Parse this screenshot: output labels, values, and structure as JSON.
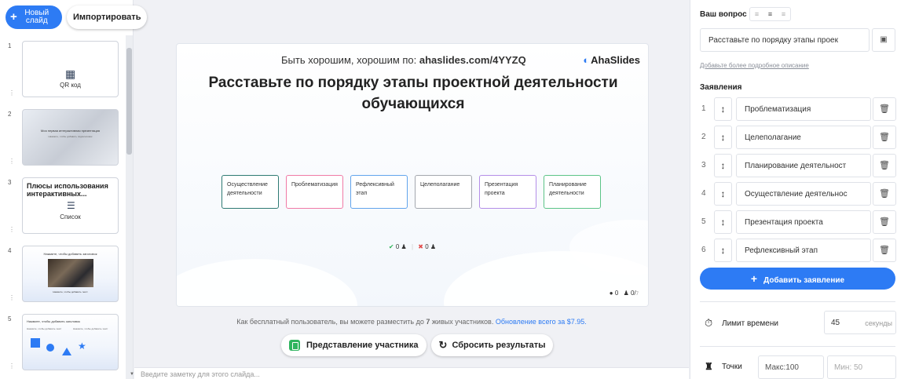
{
  "sidebar": {
    "new_slide_label": "Новый слайд",
    "import_label": "Импортировать",
    "slides": [
      {
        "num": "1",
        "label": "QR код"
      },
      {
        "num": "2",
        "title": "Моя первая интерактивная презентация",
        "subtitle": "Нажмите, чтобы добавить подзаголовок"
      },
      {
        "num": "3",
        "title": "Плюсы использования интерактивных...",
        "label": "Список"
      },
      {
        "num": "4",
        "title": "Нажмите, чтобы добавить заголовок",
        "caption": "Нажмите, чтобы добавить текст"
      },
      {
        "num": "5",
        "title": "Нажмите, чтобы добавить заголовок",
        "col1": "Нажмите, чтобы добавить текст",
        "col2": "Нажмите, чтобы добавить текст"
      }
    ]
  },
  "slide": {
    "join_prefix": "Быть хорошим, хорошим по: ",
    "join_url": "ahaslides.com/4YYZQ",
    "brand": "AhaSlides",
    "title": "Расставьте по порядку этапы проектной деятельности обучающихся",
    "items": [
      {
        "text": "Осуществление деятельности",
        "color": "#2f7a73"
      },
      {
        "text": "Проблематизация",
        "color": "#f07aa6"
      },
      {
        "text": "Рефлексивный этап",
        "color": "#62a4ec"
      },
      {
        "text": "Целеполагание",
        "color": "#a3a7ae"
      },
      {
        "text": "Презентация проекта",
        "color": "#b48ee8"
      },
      {
        "text": "Планирование деятельности",
        "color": "#5cc487"
      }
    ],
    "correct_count": "0",
    "wrong_count": "0",
    "footer_a": "0",
    "footer_b": "0",
    "footer_b_total": "7"
  },
  "upgrade": {
    "prefix": "Как бесплатный пользователь, вы можете разместить до ",
    "limit": "7",
    "middle": " живых участников. ",
    "link": "Обновление всего за $7.95."
  },
  "actions": {
    "participant_view": "Представление участника",
    "reset_results": "Сбросить результаты"
  },
  "notes": {
    "placeholder": "Введите заметку для этого слайда..."
  },
  "panel": {
    "question_label": "Ваш вопрос",
    "question_value": "Расставьте по порядку этапы проек",
    "desc_link": "Добавьте более подробное описание",
    "statements_label": "Заявления",
    "statements": [
      {
        "num": "1",
        "value": "Проблематизация"
      },
      {
        "num": "2",
        "value": "Целеполагание"
      },
      {
        "num": "3",
        "value": "Планирование деятельност"
      },
      {
        "num": "4",
        "value": "Осуществление деятельнос"
      },
      {
        "num": "5",
        "value": "Презентация проекта"
      },
      {
        "num": "6",
        "value": "Рефлексивный этап"
      }
    ],
    "add_statement": "Добавить заявление",
    "time_limit_label": "Лимит времени",
    "time_value": "45",
    "time_unit": "секунды",
    "points_label": "Точки",
    "points_max": "Макс:100",
    "points_min": "Мин: 50"
  },
  "colors": {
    "accent": "#2d7bf4",
    "success": "#32b35b",
    "danger": "#e24b4b"
  }
}
